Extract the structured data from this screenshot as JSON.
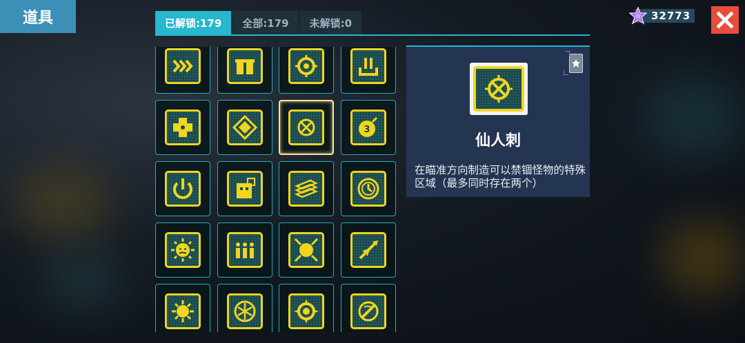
{
  "header": {
    "title": "道具",
    "currency_value": "32773"
  },
  "tabs": [
    {
      "label": "已解锁:179",
      "active": true
    },
    {
      "label": "全部:179",
      "active": false
    },
    {
      "label": "未解锁:0",
      "active": false
    }
  ],
  "colors": {
    "accent": "#25b8ce",
    "icon_yellow": "#f1d51e",
    "close": "#e84c3d",
    "detail_bg": "#243552"
  },
  "items": [
    {
      "icon": "chevrons-right-icon"
    },
    {
      "icon": "gift-box-icon"
    },
    {
      "icon": "target-ring-icon"
    },
    {
      "icon": "power-plug-icon"
    },
    {
      "icon": "puzzle-cross-icon"
    },
    {
      "icon": "diamond-icon"
    },
    {
      "icon": "cactus-spike-icon",
      "selected": true
    },
    {
      "icon": "bomb-3-icon"
    },
    {
      "icon": "power-button-icon"
    },
    {
      "icon": "cube-robot-icon"
    },
    {
      "icon": "stacked-cards-icon"
    },
    {
      "icon": "clock-dial-icon"
    },
    {
      "icon": "angry-sun-icon"
    },
    {
      "icon": "three-people-icon"
    },
    {
      "icon": "sun-frame-icon"
    },
    {
      "icon": "rocket-slash-icon"
    },
    {
      "icon": "gear-burst-icon"
    },
    {
      "icon": "snowflake-icon"
    },
    {
      "icon": "spiked-ring-icon"
    },
    {
      "icon": "swirl-slash-icon"
    }
  ],
  "detail": {
    "name": "仙人刺",
    "description": "在瞄准方向制造可以禁锢怪物的特殊区域（最多同时存在两个）",
    "icon": "cactus-spike-icon"
  }
}
